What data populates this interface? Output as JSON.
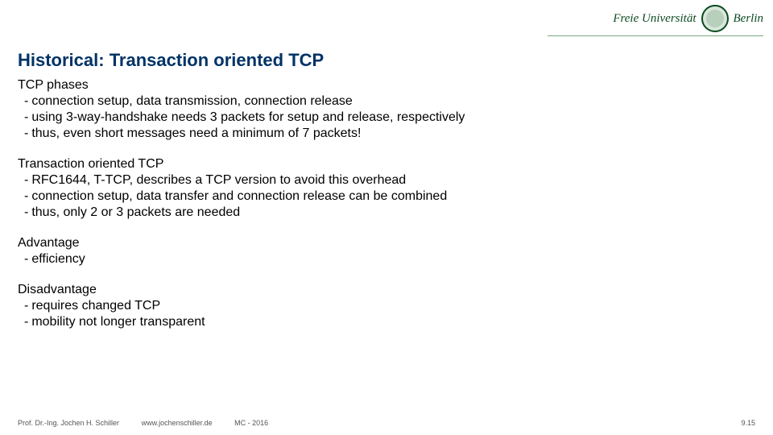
{
  "header": {
    "uni_name_left": "Freie Universität",
    "uni_name_right": "Berlin"
  },
  "title": "Historical: Transaction oriented TCP",
  "sections": [
    {
      "heading": "TCP phases",
      "bullets": [
        "connection setup, data transmission, connection release",
        "using 3-way-handshake needs 3 packets for setup and release, respectively",
        "thus, even short messages need a minimum of 7 packets!"
      ]
    },
    {
      "heading": "Transaction oriented TCP",
      "bullets": [
        "RFC1644, T-TCP, describes a TCP version to avoid this overhead",
        "connection setup, data transfer and connection release can be combined",
        "thus, only 2 or 3 packets are needed"
      ]
    },
    {
      "heading": "Advantage",
      "bullets": [
        "efficiency"
      ]
    },
    {
      "heading": "Disadvantage",
      "bullets": [
        "requires changed TCP",
        "mobility not longer transparent"
      ]
    }
  ],
  "footer": {
    "author": "Prof. Dr.-Ing. Jochen H. Schiller",
    "url": "www.jochenschiller.de",
    "course": "MC - 2016",
    "page": "9.15"
  }
}
